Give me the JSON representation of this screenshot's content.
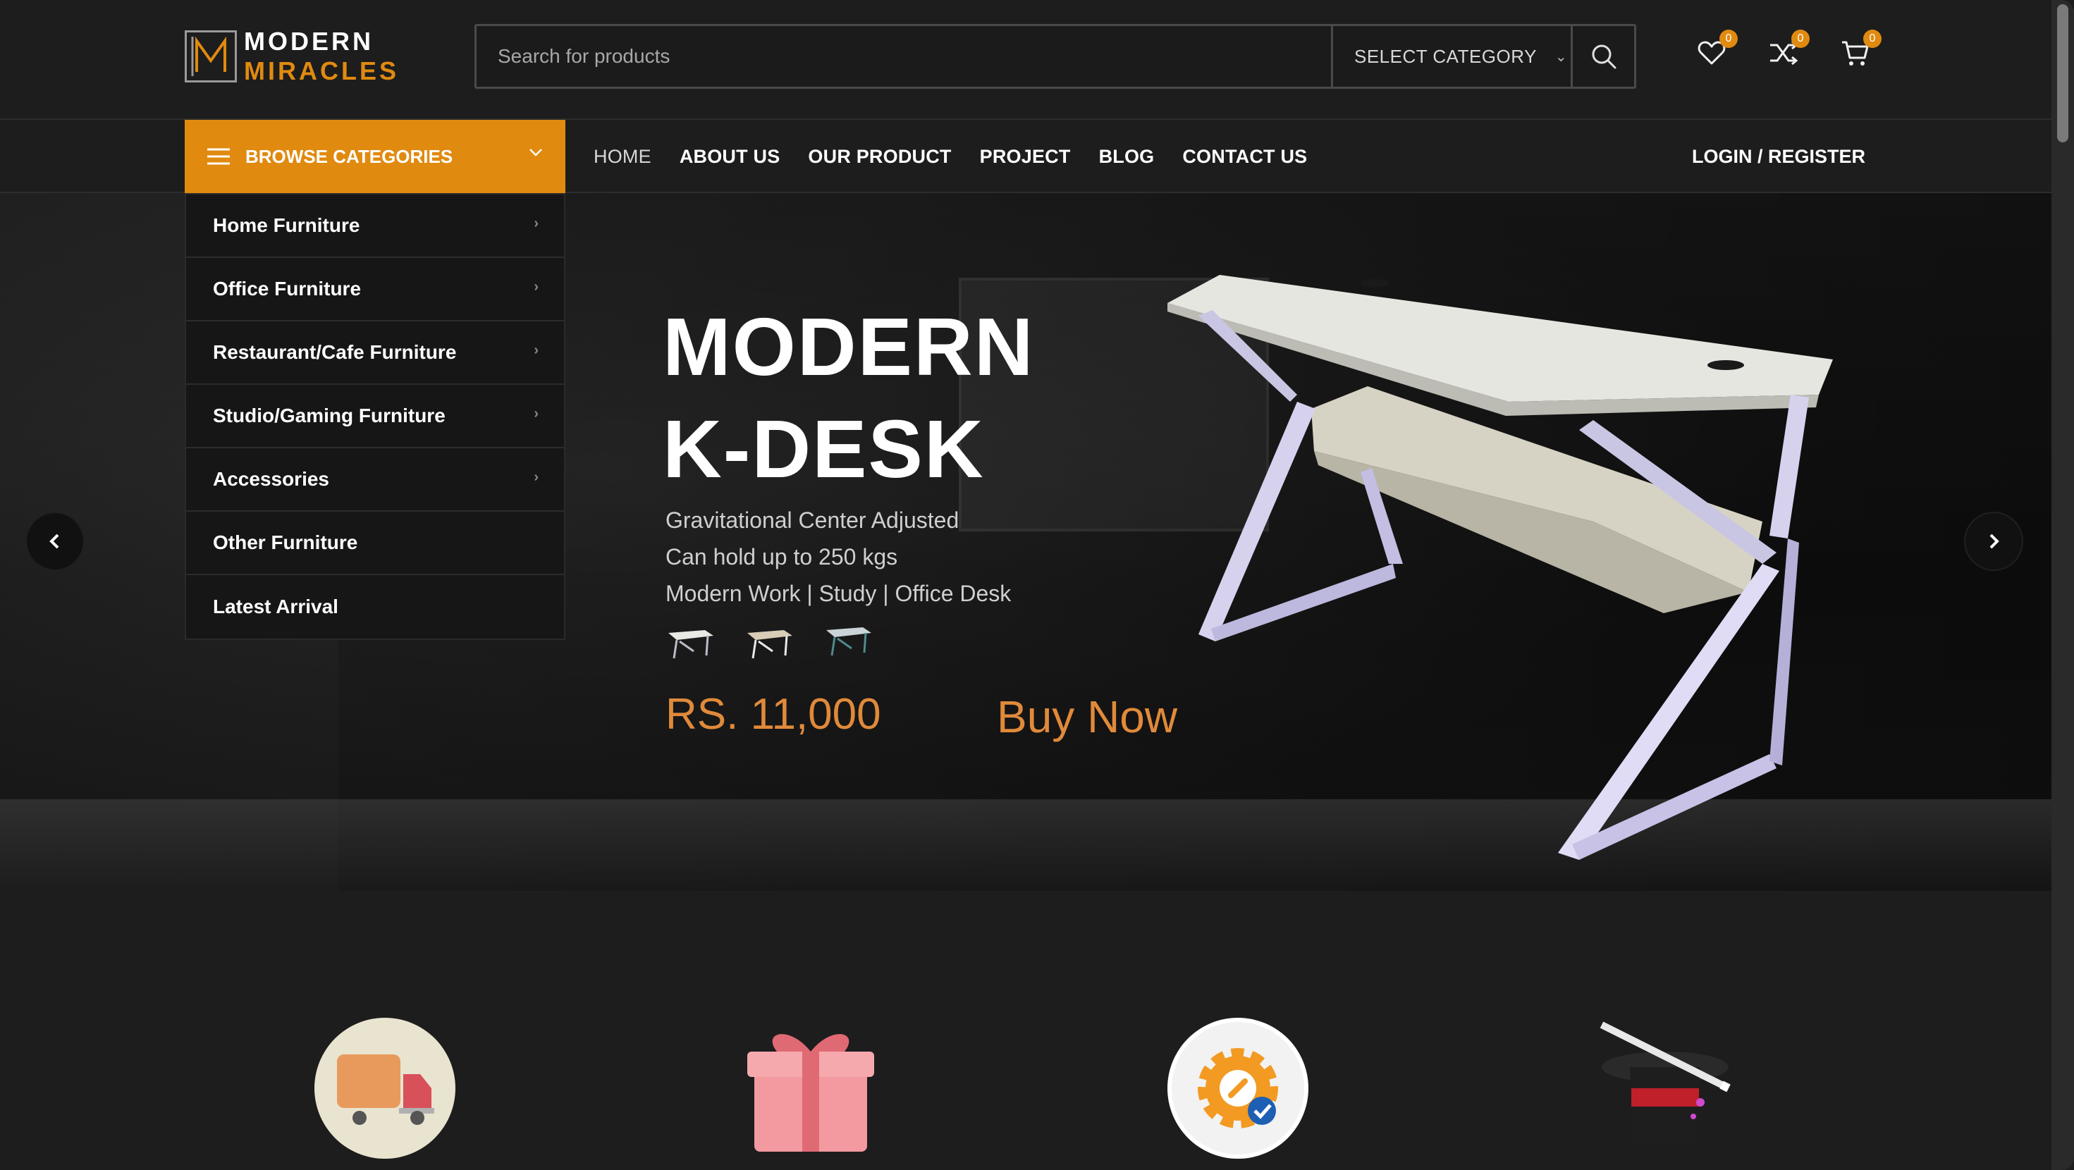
{
  "brand": {
    "line1": "MODERN",
    "line2": "MIRACLES"
  },
  "search": {
    "placeholder": "Search for products",
    "category_label": "SELECT CATEGORY"
  },
  "header_icons": {
    "wishlist_count": "0",
    "compare_count": "0",
    "cart_count": "0"
  },
  "nav": {
    "browse_label": "BROWSE CATEGORIES",
    "items": [
      "HOME",
      "ABOUT US",
      "OUR PRODUCT",
      "PROJECT",
      "BLOG",
      "CONTACT US"
    ],
    "login_label": "LOGIN / REGISTER"
  },
  "categories": [
    "Home Furniture",
    "Office Furniture",
    "Restaurant/Cafe Furniture",
    "Studio/Gaming Furniture",
    "Accessories",
    "Other Furniture",
    "Latest Arrival"
  ],
  "hero": {
    "title_line1": "MODERN",
    "title_line2": "K-DESK",
    "subtitle_lines": [
      "Gravitational Center Adjusted",
      "Can hold up to 250 kgs",
      "Modern Work | Study | Office Desk"
    ],
    "price": "RS. 11,000",
    "cta": "Buy Now"
  },
  "colors": {
    "accent": "#e08a10",
    "price": "#e08a3a",
    "background": "#1d1d1d"
  },
  "features_icons": [
    "delivery-truck-icon",
    "gift-box-icon",
    "service-gear-icon",
    "magic-hat-icon"
  ]
}
